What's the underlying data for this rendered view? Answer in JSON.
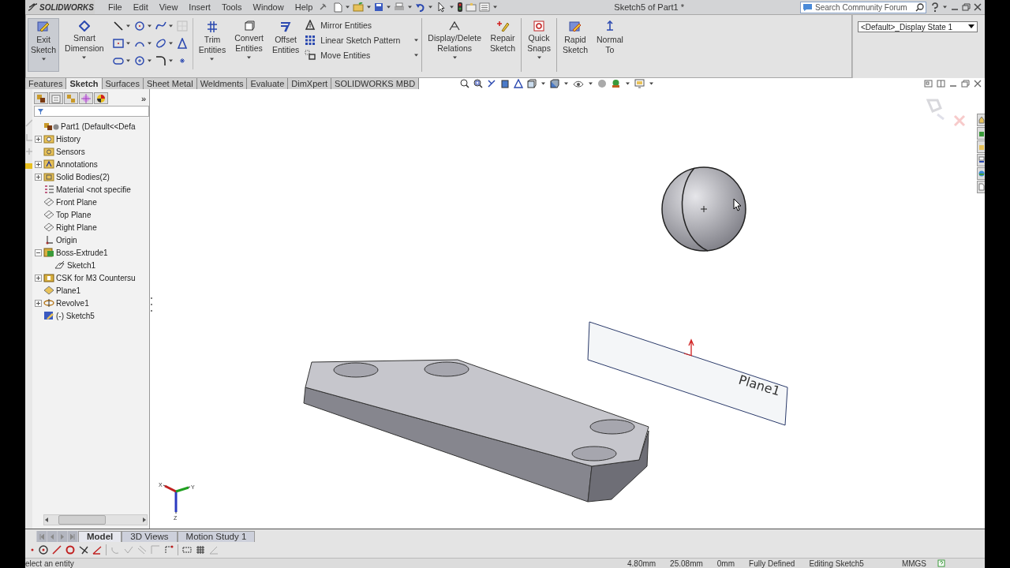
{
  "logo": {
    "text": "SOLIDWORKS"
  },
  "menu": [
    "File",
    "Edit",
    "View",
    "Insert",
    "Tools",
    "Window",
    "Help"
  ],
  "window": {
    "title": "Sketch5 of Part1 *"
  },
  "search": {
    "placeholder": "Search Community Forum"
  },
  "ribbon": [
    {
      "kind": "button",
      "label": "Exit Sketch",
      "pressed": true,
      "dropdown": true
    },
    {
      "kind": "button",
      "label": "Smart Dimension",
      "pressed": false,
      "dropdown": true
    },
    {
      "kind": "tool_grid"
    },
    {
      "kind": "button",
      "label": "Trim Entities",
      "pressed": false,
      "dropdown": true
    },
    {
      "kind": "button",
      "label": "Convert Entities",
      "pressed": false,
      "dropdown": true
    },
    {
      "kind": "button",
      "label": "Offset Entities",
      "pressed": false,
      "dropdown": false
    },
    {
      "kind": "list",
      "items": [
        {
          "label": "Mirror Entities",
          "dropdown": false
        },
        {
          "label": "Linear Sketch Pattern",
          "dropdown": true
        },
        {
          "label": "Move Entities",
          "dropdown": true
        }
      ]
    },
    {
      "kind": "separator"
    },
    {
      "kind": "button",
      "label": "Display/Delete Relations",
      "pressed": false,
      "dropdown": true
    },
    {
      "kind": "button",
      "label": "Repair Sketch",
      "pressed": false,
      "dropdown": false
    },
    {
      "kind": "separator"
    },
    {
      "kind": "button",
      "label": "Quick Snaps",
      "pressed": false,
      "dropdown": true
    },
    {
      "kind": "separator"
    },
    {
      "kind": "button",
      "label": "Rapid Sketch",
      "pressed": false,
      "dropdown": false
    },
    {
      "kind": "button",
      "label": "Normal To",
      "pressed": false,
      "dropdown": false
    }
  ],
  "display_state": {
    "value": "<Default>_Display State 1"
  },
  "command_tabs": [
    {
      "label": "Features",
      "selected": false
    },
    {
      "label": "Sketch",
      "selected": true
    },
    {
      "label": "Surfaces",
      "selected": false
    },
    {
      "label": "Sheet Metal",
      "selected": false
    },
    {
      "label": "Weldments",
      "selected": false
    },
    {
      "label": "Evaluate",
      "selected": false
    },
    {
      "label": "DimXpert",
      "selected": false
    },
    {
      "label": "SOLIDWORKS MBD",
      "selected": false
    }
  ],
  "panel_tabs": {
    "more": "»"
  },
  "feature_tree": {
    "root": {
      "label": "Part1  (Default<<Defa",
      "kind": "part",
      "children": [
        {
          "label": "History",
          "kind": "history",
          "expanded": false
        },
        {
          "label": "Sensors",
          "kind": "sensor"
        },
        {
          "label": "Annotations",
          "kind": "annotation",
          "expanded": false
        },
        {
          "label": "Solid Bodies(2)",
          "kind": "bodies",
          "expanded": false
        },
        {
          "label": "Material <not specifie",
          "kind": "material"
        },
        {
          "label": "Front Plane",
          "kind": "plane"
        },
        {
          "label": "Top Plane",
          "kind": "plane"
        },
        {
          "label": "Right Plane",
          "kind": "plane"
        },
        {
          "label": "Origin",
          "kind": "origin"
        },
        {
          "label": "Boss-Extrude1",
          "kind": "extrude",
          "expanded": true,
          "children": [
            {
              "label": "Sketch1",
              "kind": "sketch"
            }
          ]
        },
        {
          "label": "CSK for M3 Countersu",
          "kind": "hole",
          "expanded": false
        },
        {
          "label": "Plane1",
          "kind": "plane_feature"
        },
        {
          "label": "Revolve1",
          "kind": "revolve",
          "expanded": false
        },
        {
          "label": "(-) Sketch5",
          "kind": "sketch_active"
        }
      ]
    }
  },
  "viewport": {
    "plane_label": "Plane1",
    "triad_labels": [
      "X",
      "Y",
      "Z"
    ]
  },
  "bottom_tabs": [
    {
      "label": "Model",
      "selected": true
    },
    {
      "label": "3D Views",
      "selected": false
    },
    {
      "label": "Motion Study 1",
      "selected": false
    }
  ],
  "status_bar": {
    "message": "elect an entity",
    "readings": [
      "4.80mm",
      "25.08mm",
      "0mm"
    ],
    "state": "Fully Defined",
    "editing": "Editing Sketch5",
    "units": "MMGS"
  }
}
